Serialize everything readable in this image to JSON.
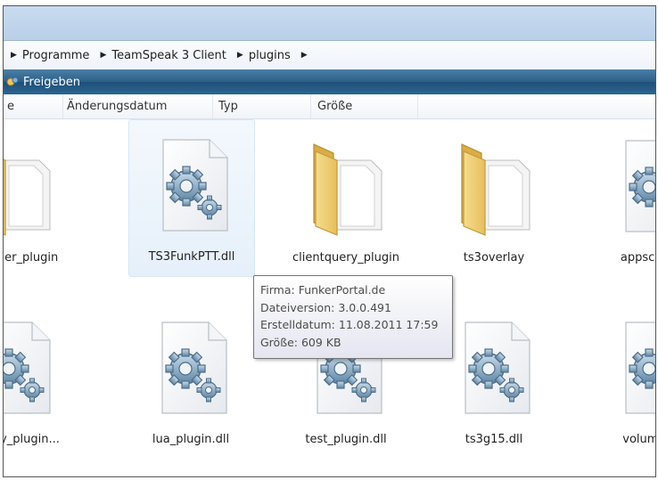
{
  "address": {
    "crumbs": [
      "Programme",
      "TeamSpeak 3 Client",
      "plugins"
    ]
  },
  "toolbar": {
    "share_label": "Freigeben"
  },
  "columns": [
    "e",
    "Änderungsdatum",
    "Typ",
    "Größe"
  ],
  "items": [
    {
      "label": "scanner_plugin",
      "icon": "folder-icon"
    },
    {
      "label": "TS3FunkPTT.dll",
      "icon": "dll-file-icon"
    },
    {
      "label": "clientquery_plugin",
      "icon": "folder-icon"
    },
    {
      "label": "ts3overlay",
      "icon": "folder-icon"
    },
    {
      "label": "appscanner",
      "icon": "dll-file-icon"
    },
    {
      "label": "tquery_plugin...",
      "icon": "dll-file-icon"
    },
    {
      "label": "lua_plugin.dll",
      "icon": "dll-file-icon"
    },
    {
      "label": "test_plugin.dll",
      "icon": "dll-file-icon"
    },
    {
      "label": "ts3g15.dll",
      "icon": "dll-file-icon"
    },
    {
      "label": "volumecon",
      "icon": "dll-file-icon"
    }
  ],
  "tooltip": {
    "lines": [
      "Firma: FunkerPortal.de",
      "Dateiversion: 3.0.0.491",
      "Erstelldatum: 11.08.2011 17:59",
      "Größe: 609 KB"
    ]
  }
}
